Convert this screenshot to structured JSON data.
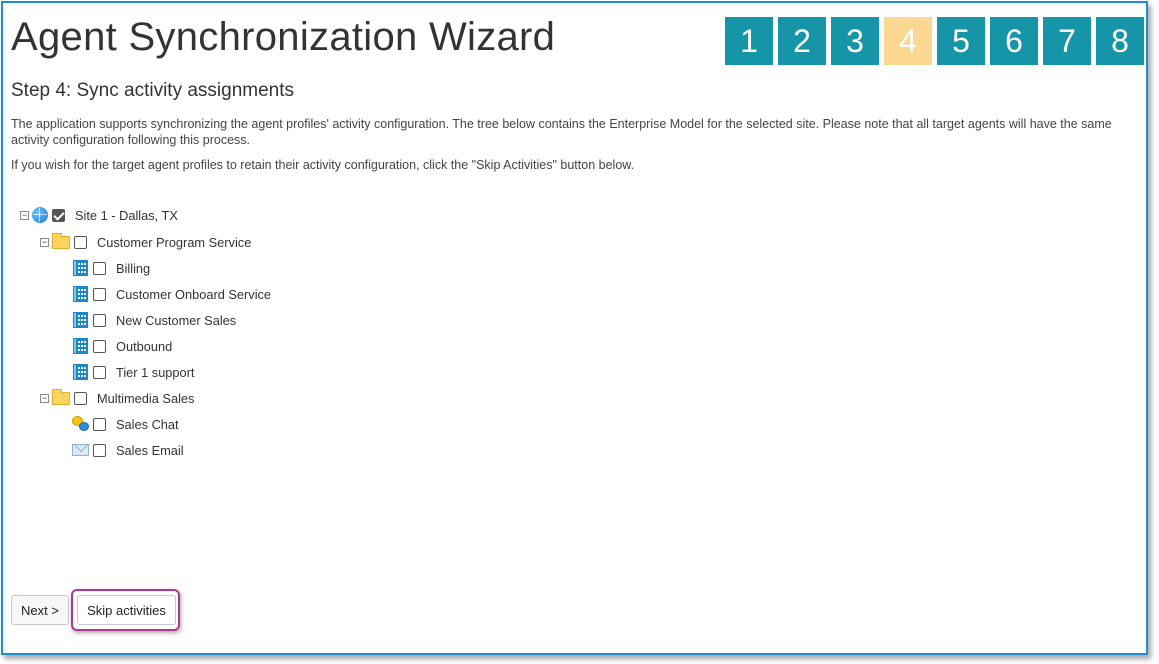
{
  "wizard": {
    "title": "Agent Synchronization Wizard",
    "steps": [
      "1",
      "2",
      "3",
      "4",
      "5",
      "6",
      "7",
      "8"
    ],
    "current_step": "4",
    "step_heading": "Step 4: Sync activity assignments",
    "description": "The application supports synchronizing the agent profiles' activity configuration. The tree below contains the Enterprise Model for the selected site. Please note that all target agents will have the same activity configuration following this process.",
    "skip_hint": "If you wish for the target agent profiles to retain their activity configuration, click the \"Skip Activities\" button below."
  },
  "tree": {
    "site": {
      "label": "Site 1 - Dallas, TX",
      "checked": true,
      "icon": "globe-icon"
    },
    "groups": [
      {
        "label": "Customer Program Service",
        "icon": "folder-icon",
        "checked": false,
        "items": [
          {
            "label": "Billing",
            "icon": "phone-queue-icon",
            "checked": false
          },
          {
            "label": "Customer Onboard Service",
            "icon": "phone-queue-icon",
            "checked": false
          },
          {
            "label": "New Customer Sales",
            "icon": "phone-queue-icon",
            "checked": false
          },
          {
            "label": "Outbound",
            "icon": "phone-queue-icon",
            "checked": false
          },
          {
            "label": "Tier 1 support",
            "icon": "phone-queue-icon",
            "checked": false
          }
        ]
      },
      {
        "label": "Multimedia Sales",
        "icon": "folder-icon",
        "checked": false,
        "items": [
          {
            "label": "Sales Chat",
            "icon": "chat-icon",
            "checked": false
          },
          {
            "label": "Sales Email",
            "icon": "email-icon",
            "checked": false
          }
        ]
      }
    ],
    "expander_glyph": "−"
  },
  "buttons": {
    "next": "Next >",
    "skip": "Skip activities"
  },
  "colors": {
    "frame_border": "#1b8fd2",
    "step_active": "#1795a8",
    "step_current": "#fbd892",
    "highlight": "#b0378f"
  }
}
